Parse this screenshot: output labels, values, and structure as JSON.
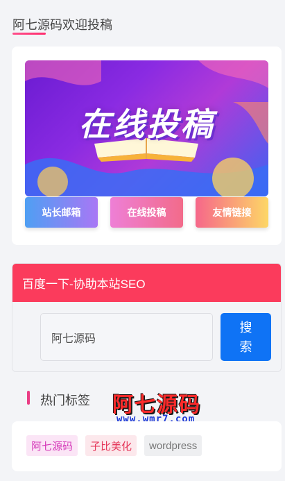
{
  "header": {
    "title": "阿七源码欢迎投稿"
  },
  "banner": {
    "text": "在线投稿"
  },
  "buttons": {
    "webmaster_mail": "站长邮箱",
    "online_submit": "在线投稿",
    "friend_links": "友情链接"
  },
  "search": {
    "title": "百度一下-协助本站SEO",
    "value": "阿七源码",
    "button": "搜\n索"
  },
  "tags": {
    "title": "热门标签",
    "items": [
      "阿七源码",
      "子比美化",
      "wordpress"
    ]
  },
  "watermark": {
    "logo": "阿七源码",
    "url": "www.wmr7.com"
  },
  "colors": {
    "accent": "#fb3b5c",
    "search_button": "#0f73f5",
    "tag_pink": "#d53ab9",
    "tag_red": "#e5375a"
  }
}
